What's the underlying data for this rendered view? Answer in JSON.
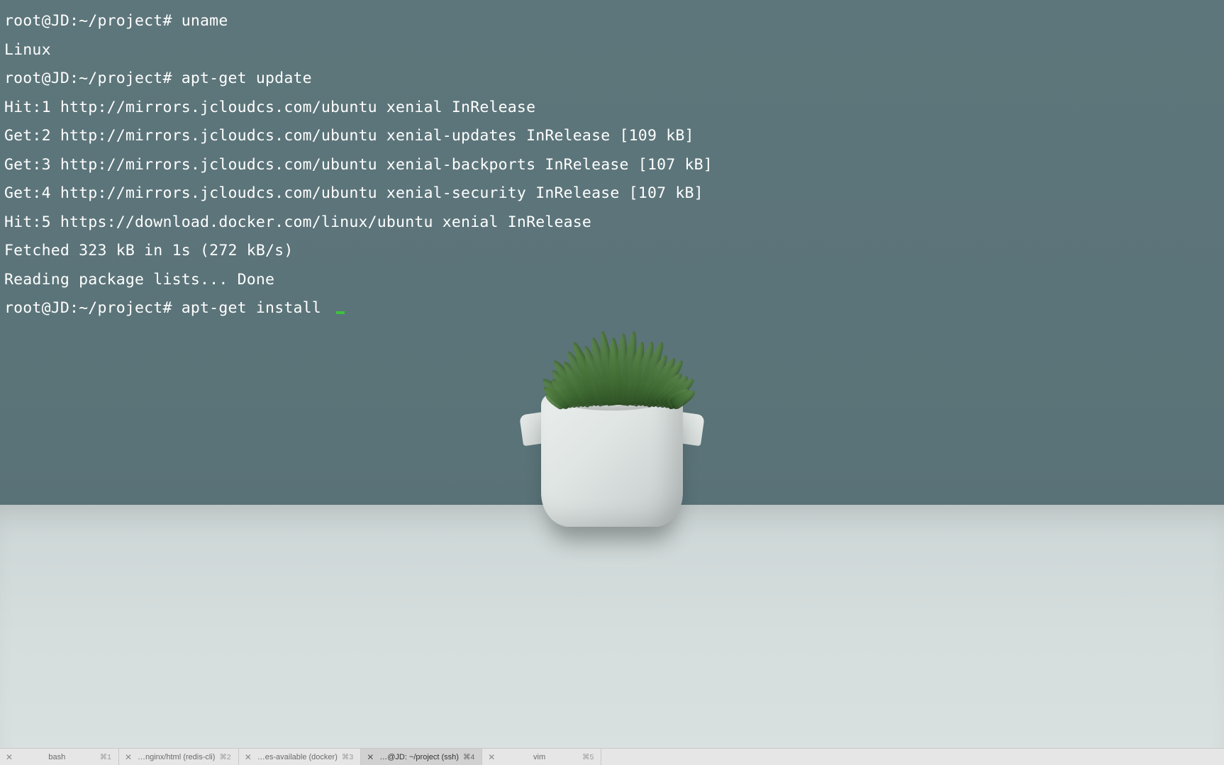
{
  "terminal": {
    "lines": [
      "root@JD:~/project# uname",
      "Linux",
      "root@JD:~/project# apt-get update",
      "Hit:1 http://mirrors.jcloudcs.com/ubuntu xenial InRelease",
      "Get:2 http://mirrors.jcloudcs.com/ubuntu xenial-updates InRelease [109 kB]",
      "Get:3 http://mirrors.jcloudcs.com/ubuntu xenial-backports InRelease [107 kB]",
      "Get:4 http://mirrors.jcloudcs.com/ubuntu xenial-security InRelease [107 kB]",
      "Hit:5 https://download.docker.com/linux/ubuntu xenial InRelease",
      "Fetched 323 kB in 1s (272 kB/s)",
      "Reading package lists... Done"
    ],
    "prompt_prefix": "root@JD:~/project# ",
    "current_input": "apt-get install "
  },
  "tabs": [
    {
      "label": "bash",
      "shortcut": "⌘1",
      "active": false
    },
    {
      "label": "…nginx/html (redis-cli)",
      "shortcut": "⌘2",
      "active": false
    },
    {
      "label": "…es-available (docker)",
      "shortcut": "⌘3",
      "active": false
    },
    {
      "label": "…@JD: ~/project (ssh)",
      "shortcut": "⌘4",
      "active": true
    },
    {
      "label": "vim",
      "shortcut": "⌘5",
      "active": false
    }
  ],
  "close_glyph": "✕"
}
